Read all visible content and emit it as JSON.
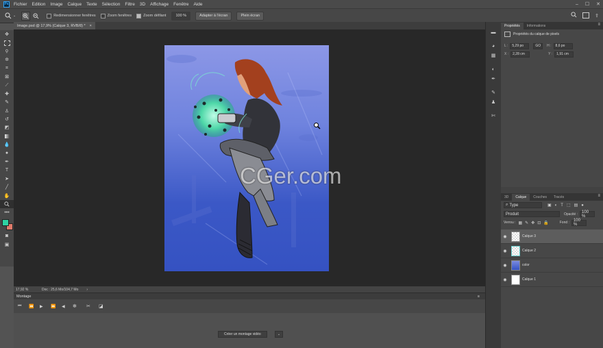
{
  "menu": {
    "items": [
      "Fichier",
      "Edition",
      "Image",
      "Calque",
      "Texte",
      "Sélection",
      "Filtre",
      "3D",
      "Affichage",
      "Fenêtre",
      "Aide"
    ]
  },
  "options": {
    "resize_windows": "Redimensionner fenêtres",
    "zoom_windows": "Zoom fenêtres",
    "scrubby_zoom": "Zoom défilant",
    "zoom_value": "100 %",
    "fit_screen": "Adapter à l'écran",
    "fill_screen": "Plein écran"
  },
  "document": {
    "tab_title": "Image.psd @ 17,9% (Calque 3, RVB/8) *",
    "close": "×"
  },
  "status": {
    "zoom": "17,92 %",
    "doc_info": "Doc : 25,6 Mo/104,7 Mo"
  },
  "watermark": "CGer.com",
  "timeline": {
    "title": "Montage",
    "create_video": "Créer un montage vidéo"
  },
  "properties": {
    "tabs": [
      "Propriétés",
      "Informations"
    ],
    "heading": "Propriétés du calque de pixels",
    "L": "5,29 po",
    "H": "8,6 po",
    "X": "2,28 cm",
    "Y": "1,91 cm",
    "L_label": "L :",
    "H_label": "H :",
    "X_label": "X :",
    "Y_label": "Y :",
    "link": "GO"
  },
  "layers": {
    "tabs": [
      "3D",
      "Calque",
      "Couches",
      "Tracés"
    ],
    "filter_label": "Type",
    "blend_mode": "Produit",
    "opacity_label": "Opacité :",
    "opacity": "100 %",
    "lock_label": "Verrou :",
    "fill_label": "Fond :",
    "fill": "100 %",
    "items": [
      {
        "name": "Calque 3"
      },
      {
        "name": "Calque 2"
      },
      {
        "name": "color"
      },
      {
        "name": "Calque 1"
      }
    ]
  },
  "colors": {
    "foreground": "#2fd3a3",
    "background": "#e07a6a"
  }
}
